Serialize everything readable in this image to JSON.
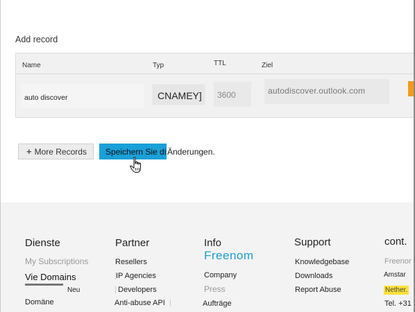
{
  "add_record": {
    "title": "Add record",
    "columns": {
      "name": "Name",
      "type": "Typ",
      "ttl": "TTL",
      "target": "Ziel"
    },
    "row": {
      "name": "auto discover",
      "type": "CNAMEY]",
      "ttl": "3600",
      "target": "autodiscover.outlook.com"
    }
  },
  "buttons": {
    "more_records": "More Records",
    "save": "Speichern Sie die",
    "save_tail": "Änderungen."
  },
  "footer": {
    "services": {
      "heading": "Dienste",
      "items": [
        "My Subscriptions",
        "Vie Domains",
        "Neu",
        "Domäne"
      ]
    },
    "partner": {
      "heading": "Partner",
      "items": [
        "Resellers",
        "IP Agencies",
        "Developers",
        "Anti-abuse API"
      ]
    },
    "info": {
      "heading": "Info",
      "brand": "Freenom",
      "items": [
        "Company",
        "Press",
        "Aufträge"
      ]
    },
    "support": {
      "heading": "Support",
      "items": [
        "Knowledgebase",
        "Downloads",
        "Report Abuse"
      ]
    },
    "contact": {
      "heading": "cont.",
      "items": [
        "Freenor",
        "Amstar",
        "Nether.",
        "Tel. +31"
      ]
    }
  },
  "colors": {
    "accent": "#1aa0d8",
    "action_orange": "#f39a1c",
    "footer_bg": "#f3f3f3",
    "badge_yellow": "#fde23a"
  },
  "icons": {
    "more_records": "plus-icon",
    "cursor": "hand-pointer-icon"
  }
}
